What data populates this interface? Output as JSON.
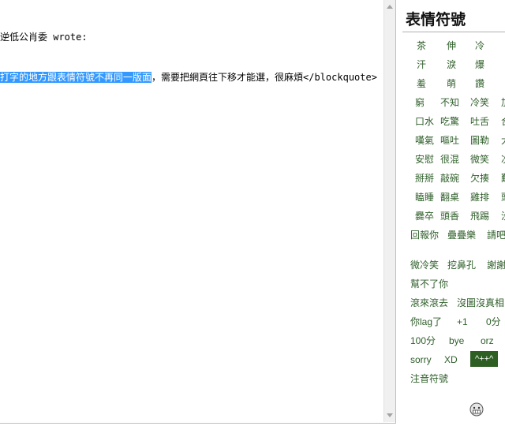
{
  "editor": {
    "line1": "逆低公肖委 wrote:",
    "line2_selected": "打字的地方跟表情符號不再同一版面",
    "line2_rest": "，需要把網頁往下移才能選，很麻煩</blockquote>"
  },
  "panel": {
    "title": "表情符號",
    "rows": [
      [
        "茶",
        "伸",
        "冷"
      ],
      [
        "汗",
        "淚",
        "爆"
      ],
      [
        "羞",
        "萌",
        "讚"
      ],
      [
        "窮",
        "不知",
        "冷笑",
        "加"
      ],
      [
        "口水",
        "吃驚",
        "吐舌",
        "合"
      ],
      [
        "嘆氣",
        "嘔吐",
        "圖勒",
        "大"
      ],
      [
        "安慰",
        "很混",
        "微笑",
        "次"
      ],
      [
        "掰掰",
        "敲碗",
        "欠揍",
        "難"
      ],
      [
        "瞌睡",
        "翻桌",
        "雞排",
        "頭"
      ],
      [
        "爨卒",
        "頭香",
        "飛踢",
        "沒"
      ],
      [
        "回報你",
        "疊疊樂",
        "請吧"
      ],
      [
        "微冷笑",
        "挖鼻孔",
        "謝謝"
      ],
      [
        "幫不了你"
      ],
      [
        "滾來滾去",
        "沒圖沒真相"
      ],
      [
        "你lag了",
        "+1",
        "0分"
      ],
      [
        "100分",
        "bye",
        "orz"
      ],
      [
        "sorry",
        "XD",
        "^++^"
      ],
      [
        "注音符號"
      ]
    ],
    "active_item": "^++^",
    "colors": {
      "link": "#2f5f2a",
      "active_bg": "#2d5e22"
    },
    "footer_icon": "grin-face-icon"
  }
}
